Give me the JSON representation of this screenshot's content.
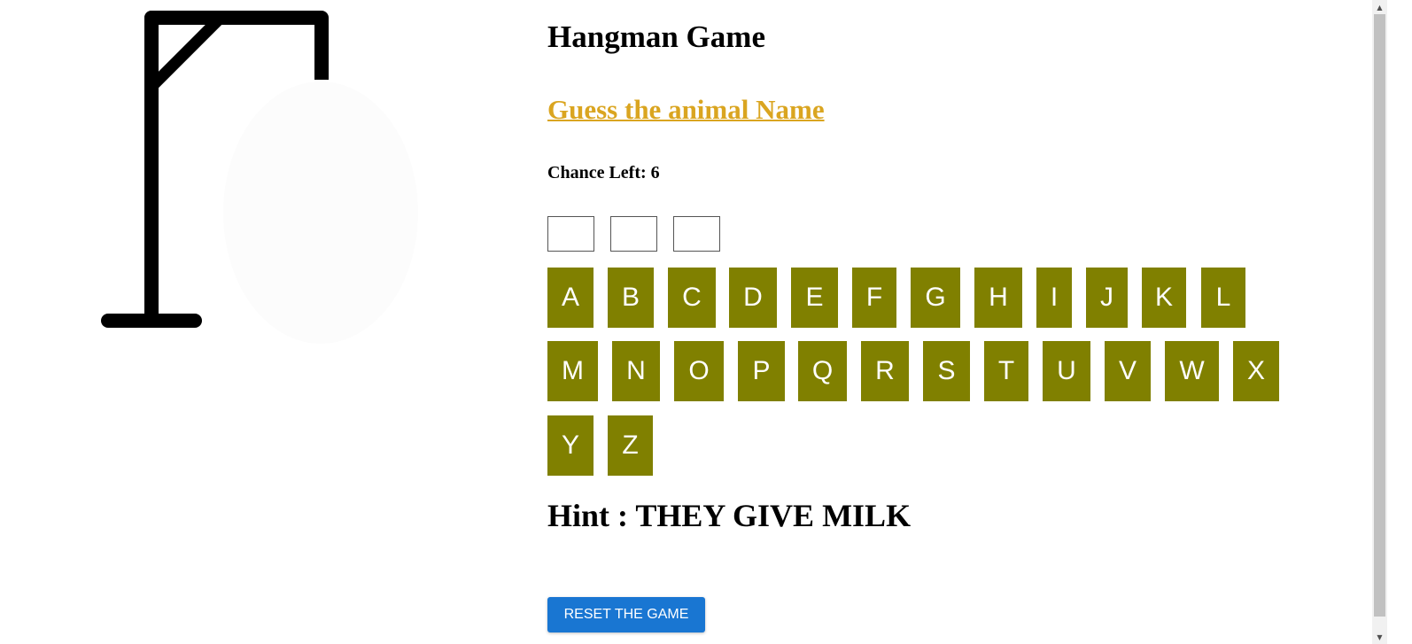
{
  "game": {
    "title": "Hangman Game",
    "subtitle": "Guess the animal Name",
    "chance_label": "Chance Left: ",
    "chances_left": "6",
    "word_slots": [
      "",
      "",
      ""
    ],
    "letters": [
      "A",
      "B",
      "C",
      "D",
      "E",
      "F",
      "G",
      "H",
      "I",
      "J",
      "K",
      "L",
      "M",
      "N",
      "O",
      "P",
      "Q",
      "R",
      "S",
      "T",
      "U",
      "V",
      "W",
      "X",
      "Y",
      "Z"
    ],
    "hint_label": "Hint : ",
    "hint_text": "THEY GIVE MILK",
    "reset_label": "RESET THE GAME"
  },
  "colors": {
    "key_bg": "#808000",
    "subtitle": "#daa520",
    "reset_bg": "#1976d2",
    "gallows": "#000000"
  },
  "icons": {
    "scroll_up": "triangle-up",
    "scroll_down": "triangle-down"
  }
}
